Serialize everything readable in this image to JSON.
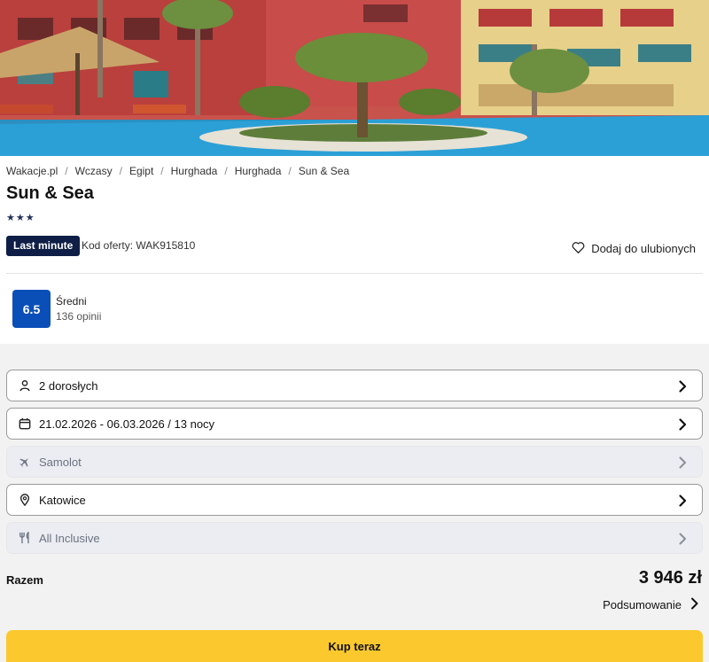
{
  "hero": {
    "image_alt": "Hotel pool with palm trees"
  },
  "breadcrumb": [
    "Wakacje.pl",
    "Wczasy",
    "Egipt",
    "Hurghada",
    "Hurghada",
    "Sun & Sea"
  ],
  "hotel": {
    "name": "Sun & Sea",
    "stars": "★★★",
    "badge": "Last minute",
    "offer_code": "Kod oferty: WAK915810",
    "favorite_label": "Dodaj do ulubionych"
  },
  "rating": {
    "score": "6.5",
    "label": "Średni",
    "reviews": "136 opinii"
  },
  "options": {
    "travelers": "2 dorosłych",
    "dates": "21.02.2026 - 06.03.2026 / 13 nocy",
    "transport": "Samolot",
    "departure": "Katowice",
    "board": "All Inclusive"
  },
  "summary": {
    "total_label": "Razem",
    "total_price": "3 946 zł",
    "summary_link": "Podsumowanie",
    "buy_button": "Kup teraz"
  },
  "colors": {
    "badge": "#0e1e46",
    "score": "#0a4fb8",
    "buy": "#fbc92e"
  }
}
